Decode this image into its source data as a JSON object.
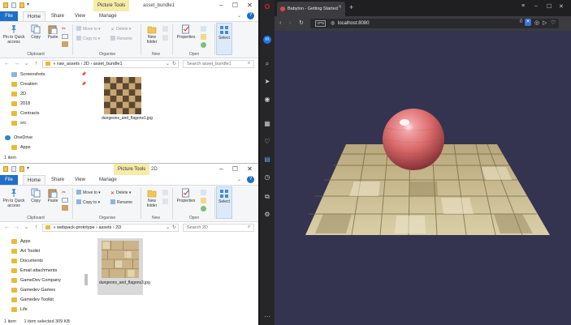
{
  "explorer_top": {
    "context_tab": "Picture Tools",
    "title": "asset_bundle1",
    "tabs": [
      "File",
      "Home",
      "Share",
      "View",
      "Manage"
    ],
    "ribbon": {
      "pin": "Pin to Quick access",
      "copy": "Copy",
      "paste": "Paste",
      "move_to": "Move to",
      "copy_to": "Copy to",
      "delete": "Delete",
      "rename": "Rename",
      "new_folder": "New folder",
      "properties": "Properties",
      "select": "Select",
      "groups": [
        "Clipboard",
        "Organise",
        "New",
        "Open"
      ]
    },
    "breadcrumb": [
      "«",
      "raw_assets",
      "2D",
      "asset_bundle1"
    ],
    "search_placeholder": "Search asset_bundle1",
    "nav_items": [
      {
        "label": "Screenshots",
        "pinned": true
      },
      {
        "label": "Creation",
        "pinned": true
      },
      {
        "label": "2D",
        "pinned": false
      },
      {
        "label": "2018",
        "pinned": false
      },
      {
        "label": "Contracts",
        "pinned": false
      },
      {
        "label": "src",
        "pinned": false
      }
    ],
    "onedrive": "OneDrive",
    "apps": "Apps",
    "file": {
      "name": "dungeons_and_flagons1.jpg"
    },
    "status": "1 item"
  },
  "explorer_bottom": {
    "context_tab": "Picture Tools",
    "title": "2D",
    "tabs": [
      "File",
      "Home",
      "Share",
      "View",
      "Manage"
    ],
    "ribbon": {
      "pin": "Pin to Quick access",
      "copy": "Copy",
      "paste": "Paste",
      "move_to": "Move to",
      "copy_to": "Copy to",
      "delete": "Delete",
      "rename": "Rename",
      "new_folder": "New folder",
      "properties": "Properties",
      "select": "Select",
      "groups": [
        "Clipboard",
        "Organise",
        "New",
        "Open"
      ]
    },
    "breadcrumb": [
      "«",
      "webpack-prototype",
      "assets",
      "2D"
    ],
    "search_placeholder": "Search 2D",
    "nav_items": [
      {
        "label": "Apps"
      },
      {
        "label": "Art Toolkit"
      },
      {
        "label": "Documents"
      },
      {
        "label": "Email attachments"
      },
      {
        "label": "GameDev Company"
      },
      {
        "label": "Gamedev Games"
      },
      {
        "label": "Gamedev Toolkit"
      },
      {
        "label": "Life"
      }
    ],
    "file": {
      "name": "dungeons_and_flagons3.jpg"
    },
    "status_items": "1 item",
    "status_selected": "1 item selected  309 KB"
  },
  "browser": {
    "tab_title": "Babylon - Getting Started",
    "url": "localhost:8080",
    "vpn_label": "VPN",
    "badge_count": "0",
    "colors": {
      "bg": "#343450",
      "sphere": "#d86868",
      "accent": "#e0252f"
    }
  }
}
